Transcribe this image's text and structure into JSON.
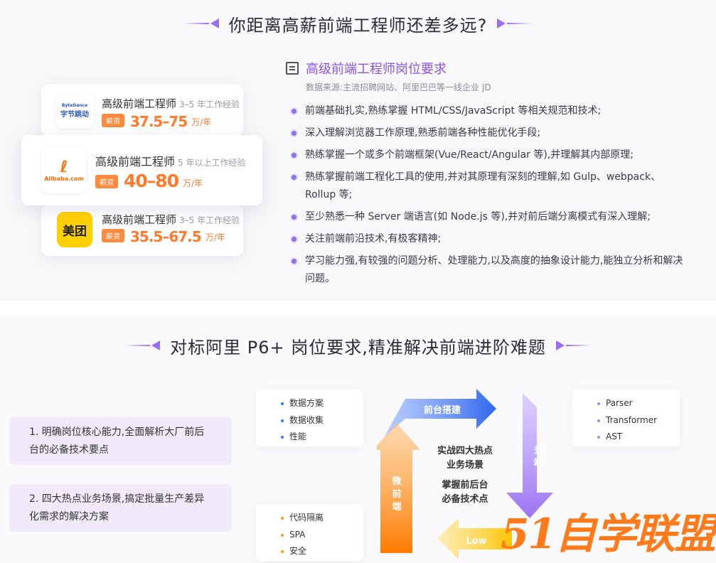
{
  "top": {
    "heading": "你距离高薪前端工程师还差多远?",
    "companies": [
      {
        "logo_text": "字节跳动",
        "logo_sub": "ByteDance",
        "role": "高级前端工程师",
        "experience": "3–5 年工作经验",
        "badge": "薪资",
        "salary": "37.5–75",
        "unit": "万/年"
      },
      {
        "logo_text": "Alibaba.com",
        "logo_sub": "",
        "role": "高级前端工程师",
        "experience": "5 年以上工作经验",
        "badge": "薪资",
        "salary": "40–80",
        "unit": "万/年"
      },
      {
        "logo_text": "美团",
        "logo_sub": "",
        "role": "高级前端工程师",
        "experience": "3–5 年工作经验",
        "badge": "薪资",
        "salary": "35.5–67.5",
        "unit": "万/年"
      }
    ],
    "requirements": {
      "icon": "document-list-icon",
      "title": "高级前端工程师岗位要求",
      "source": "数据来源:主流招聘网站、阿里巴巴等一线企业 JD",
      "items": [
        "前端基础扎实,熟练掌握 HTML/CSS/JavaScript 等相关规范和技术;",
        "深入理解浏览器工作原理,熟悉前端各种性能优化手段;",
        "熟练掌握一个或多个前端框架(Vue/React/Angular 等),并理解其内部原理;",
        "熟练掌握前端工程化工具的使用,并对其原理有深刻的理解,如 Gulp、webpack、Rollup 等;",
        "至少熟悉一种 Server 端语言(如 Node.js 等),并对前后端分离模式有深入理解;",
        "关注前端前沿技术,有极客精神;",
        "学习能力强,有较强的问题分析、处理能力,以及高度的抽象设计能力,能独立分析和解决问题。"
      ]
    }
  },
  "bottom": {
    "heading": "对标阿里 P6+ 岗位要求,精准解决前端进阶难题",
    "pain_points": [
      "1. 明确岗位核心能力,全面解析大厂前后台的必备技术要点",
      "2. 四大热点业务场景,搞定批量生产差异化需求的解决方案"
    ],
    "box_data": [
      "数据方案",
      "数据收集",
      "性能"
    ],
    "box_parser": [
      "Parser",
      "Transformer",
      "AST"
    ],
    "box_isolation": [
      "代码隔离",
      "SPA",
      "安全"
    ],
    "arrows": {
      "frontend": "前台搭建",
      "multi": "多端",
      "micro": "微前端",
      "lowcode": "Low"
    },
    "center": {
      "line1": "实战四大热点",
      "line2": "业务场景",
      "line3": "掌握前后台",
      "line4": "必备技术点"
    }
  },
  "watermark": "51自学联盟",
  "colors": {
    "accent_purple": "#8a55e8",
    "salary_orange": "#ff7a2a",
    "arrow_blue": "#3c74f0",
    "arrow_violet": "#a887f5",
    "arrow_orange": "#ff9a1a"
  }
}
